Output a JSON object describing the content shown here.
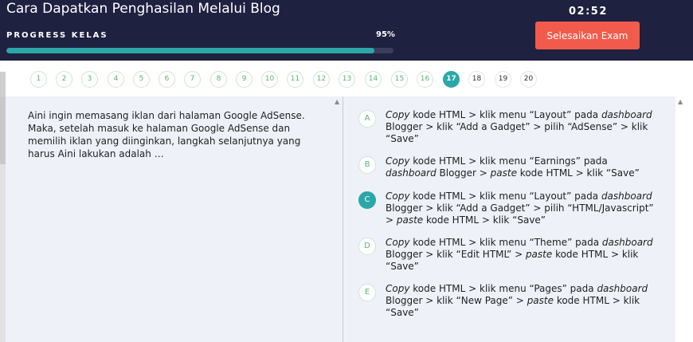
{
  "header": {
    "title": "Cara Dapatkan Penghasilan Melalui Blog",
    "progress_label": "PROGRESS KELAS",
    "progress_percent_text": "95%",
    "progress_value": 0.95,
    "timer": "02:52",
    "finish_button": "Selesaikan Exam",
    "accent_color": "#2aa7a8",
    "finish_color": "#f25b4b"
  },
  "nav": {
    "numbers": [
      "1",
      "2",
      "3",
      "4",
      "5",
      "6",
      "7",
      "8",
      "9",
      "10",
      "11",
      "12",
      "13",
      "14",
      "15",
      "16",
      "17",
      "18",
      "19",
      "20"
    ],
    "active_number": "17"
  },
  "question": {
    "text": "Aini ingin memasang iklan dari halaman Google AdSense. Maka, setelah masuk ke halaman Google AdSense dan memilih iklan yang diinginkan, langkah selanjutnya yang harus Aini lakukan adalah …"
  },
  "options": [
    {
      "letter": "A",
      "lead": "Copy",
      "m1": " kode HTML > klik menu “Layout” pada ",
      "em2": "dashboard",
      "rest": " Blogger > klik “Add a Gadget” > pilih “AdSense” > klik “Save”",
      "selected": false
    },
    {
      "letter": "B",
      "lead": "Copy",
      "m1": " kode HTML > klik menu “Earnings” pada ",
      "em2": "dashboard",
      "rest_a": " Blogger > ",
      "em3": "paste",
      "rest": " kode HTML > klik “Save”",
      "selected": false
    },
    {
      "letter": "C",
      "lead": "Copy",
      "m1": " kode HTML > klik menu “Layout” pada ",
      "em2": "dashboard",
      "rest_a": " Blogger > klik “Add a Gadget” > pilih “HTML/Javascript” > ",
      "em3": "paste",
      "rest": " kode HTML > klik “Save”",
      "selected": true
    },
    {
      "letter": "D",
      "lead": "Copy",
      "m1": " kode HTML > klik menu “Theme” pada ",
      "em2": "dashboard",
      "rest_a": " Blogger > klik “Edit HTML” > ",
      "em3": "paste",
      "rest": " kode HTML > klik “Save”",
      "selected": false
    },
    {
      "letter": "E",
      "lead": "Copy",
      "m1": " kode HTML > klik menu “Pages” pada ",
      "em2": "dashboard",
      "rest_a": " Blogger > klik “New Page” > ",
      "em3": "paste",
      "rest": " kode HTML > klik “Save”",
      "selected": false
    }
  ],
  "icons": {
    "scroll_up": "▲"
  }
}
